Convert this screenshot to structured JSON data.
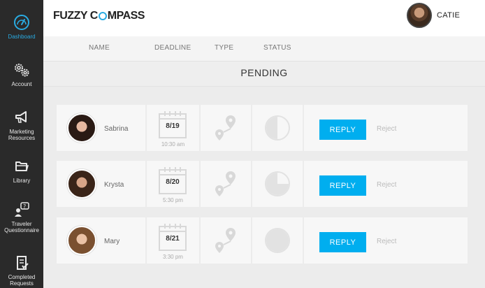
{
  "app": {
    "logo_part1": "FUZZY C",
    "logo_part2": "MPASS"
  },
  "user": {
    "name": "CATIE"
  },
  "sidebar": {
    "items": [
      {
        "label": "Dashboard",
        "icon": "dashboard-gauge-icon",
        "active": true
      },
      {
        "label": "Account",
        "icon": "gears-icon"
      },
      {
        "label": "Marketing Resources",
        "icon": "megaphone-icon"
      },
      {
        "label": "Library",
        "icon": "folder-icon"
      },
      {
        "label": "Traveler Questionnaire",
        "icon": "person-question-icon"
      },
      {
        "label": "Completed Requests",
        "icon": "checklist-icon"
      }
    ]
  },
  "columns": [
    "NAME",
    "DEADLINE",
    "TYPE",
    "STATUS"
  ],
  "section": {
    "title": "PENDING"
  },
  "requests": [
    {
      "name": "Sabrina",
      "date": "8/19",
      "time": "10:30 am",
      "type_icon": "route-pin-icon",
      "status_fill": 0.5,
      "reply_label": "REPLY",
      "reject_label": "Reject"
    },
    {
      "name": "Krysta",
      "date": "8/20",
      "time": "5:30 pm",
      "type_icon": "route-pin-icon",
      "status_fill": 0.75,
      "reply_label": "REPLY",
      "reject_label": "Reject"
    },
    {
      "name": "Mary",
      "date": "8/21",
      "time": "3:30 pm",
      "type_icon": "route-pin-icon",
      "status_fill": 1.0,
      "reply_label": "REPLY",
      "reject_label": "Reject"
    }
  ],
  "colors": {
    "accent": "#00aeef",
    "sidebar_bg": "#2a2a2a",
    "active_nav": "#29abe2"
  }
}
